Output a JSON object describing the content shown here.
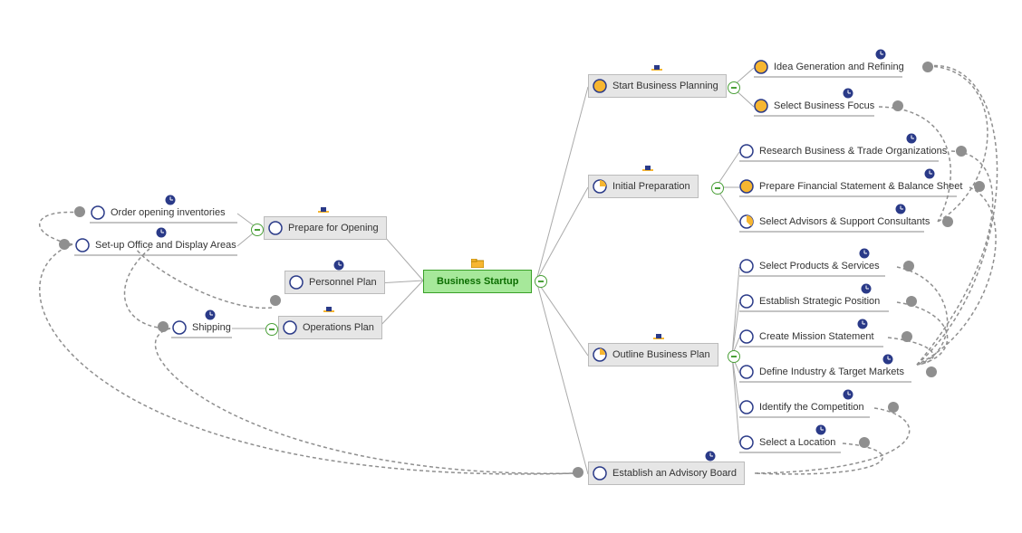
{
  "center": {
    "label": "Business Startup"
  },
  "left_branches": {
    "prepare": {
      "label": "Prepare for Opening",
      "children": [
        {
          "label": "Order opening inventories"
        },
        {
          "label": "Set-up Office and Display Areas"
        }
      ]
    },
    "personnel": {
      "label": "Personnel Plan"
    },
    "operations": {
      "label": "Operations Plan",
      "children": [
        {
          "label": "Shipping"
        }
      ]
    }
  },
  "right_branches": {
    "start_planning": {
      "label": "Start Business Planning",
      "children": [
        {
          "label": "Idea Generation and Refining"
        },
        {
          "label": "Select Business Focus"
        }
      ]
    },
    "initial_prep": {
      "label": "Initial Preparation",
      "children": [
        {
          "label": "Research Business & Trade Organizations"
        },
        {
          "label": "Prepare Financial Statement & Balance Sheet"
        },
        {
          "label": "Select Advisors & Support Consultants"
        }
      ]
    },
    "outline": {
      "label": "Outline Business Plan",
      "children": [
        {
          "label": "Select Products & Services"
        },
        {
          "label": "Establish Strategic Position"
        },
        {
          "label": "Create Mission Statement"
        },
        {
          "label": "Define Industry & Target Markets"
        },
        {
          "label": "Identify the Competition"
        },
        {
          "label": "Select a Location"
        }
      ]
    },
    "advisory": {
      "label": "Establish an Advisory Board"
    }
  },
  "icons": {
    "folder": "folder-icon",
    "clock": "clock-icon",
    "hat": "hat-icon",
    "progress_none": "progress-0",
    "progress_partial": "progress-50",
    "progress_full": "progress-100"
  },
  "colors": {
    "center_bg": "#a6e89a",
    "box_bg": "#e6e6e6",
    "connector": "#aaaaaa",
    "dashed_link": "#8f8f8f",
    "clock": "#2a3a88",
    "progress_fill": "#f7b631",
    "progress_ring": "#2a3a88"
  }
}
